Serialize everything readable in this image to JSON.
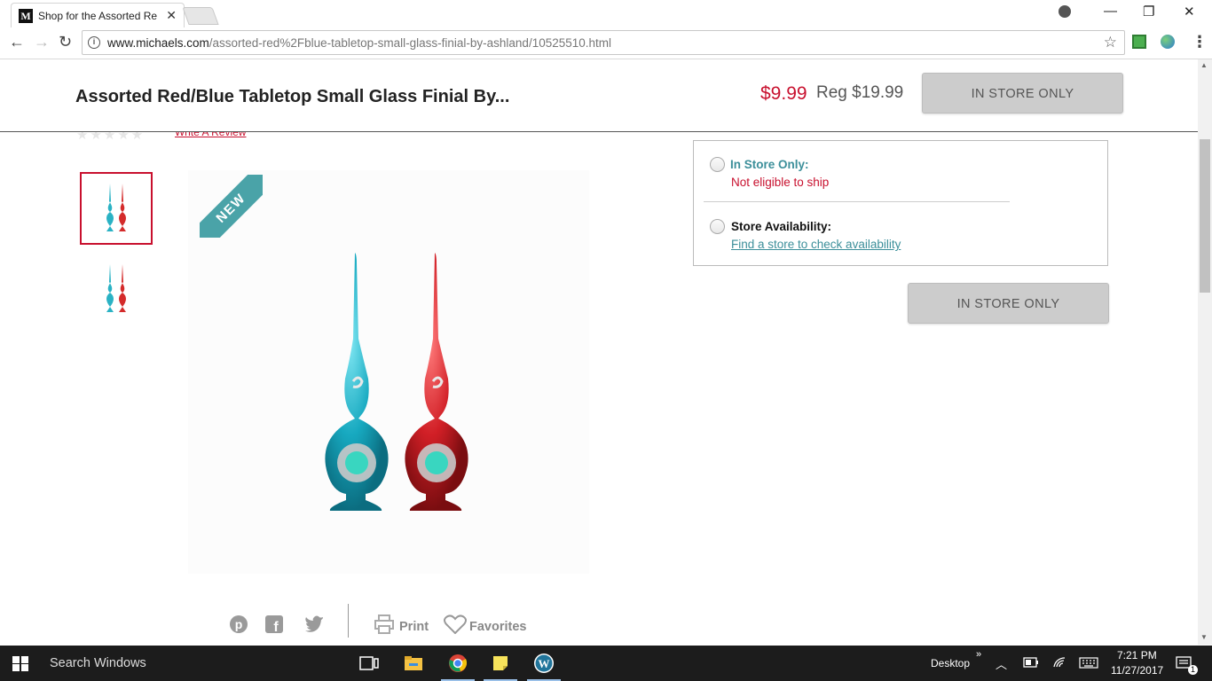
{
  "browser": {
    "tab_title": "Shop for the Assorted Re",
    "tab_close": "✕",
    "url_domain": "www.michaels.com",
    "url_path": "/assorted-red%2Fblue-tabletop-small-glass-finial-by-ashland/10525510.html",
    "window_controls": {
      "minimize": "—",
      "restore": "❐",
      "close": "✕"
    },
    "nav": {
      "back": "←",
      "forward": "→",
      "reload": "↻"
    }
  },
  "header": {
    "product_title": "Assorted Red/Blue Tabletop Small Glass Finial By...",
    "sale_price": "$9.99",
    "reg_price": "Reg $19.99",
    "button_label": "IN STORE ONLY"
  },
  "rating": {
    "stars": "★★★★★",
    "write_review": "Write A Review"
  },
  "product": {
    "badge": "NEW"
  },
  "availability": {
    "in_store_title": "In Store Only:",
    "in_store_sub": "Not eligible to ship",
    "store_title": "Store Availability:",
    "store_link": "Find a store to check availability",
    "button_label": "IN STORE ONLY"
  },
  "share": {
    "print_label": "Print",
    "favorites_label": "Favorites"
  },
  "taskbar": {
    "search_placeholder": "Search Windows",
    "desktop_label": "Desktop",
    "time": "7:21 PM",
    "date": "11/27/2017",
    "notification_count": "1"
  },
  "colors": {
    "brand_red": "#c8102e",
    "teal": "#4aa3a8",
    "button_grey": "#cccccc"
  }
}
